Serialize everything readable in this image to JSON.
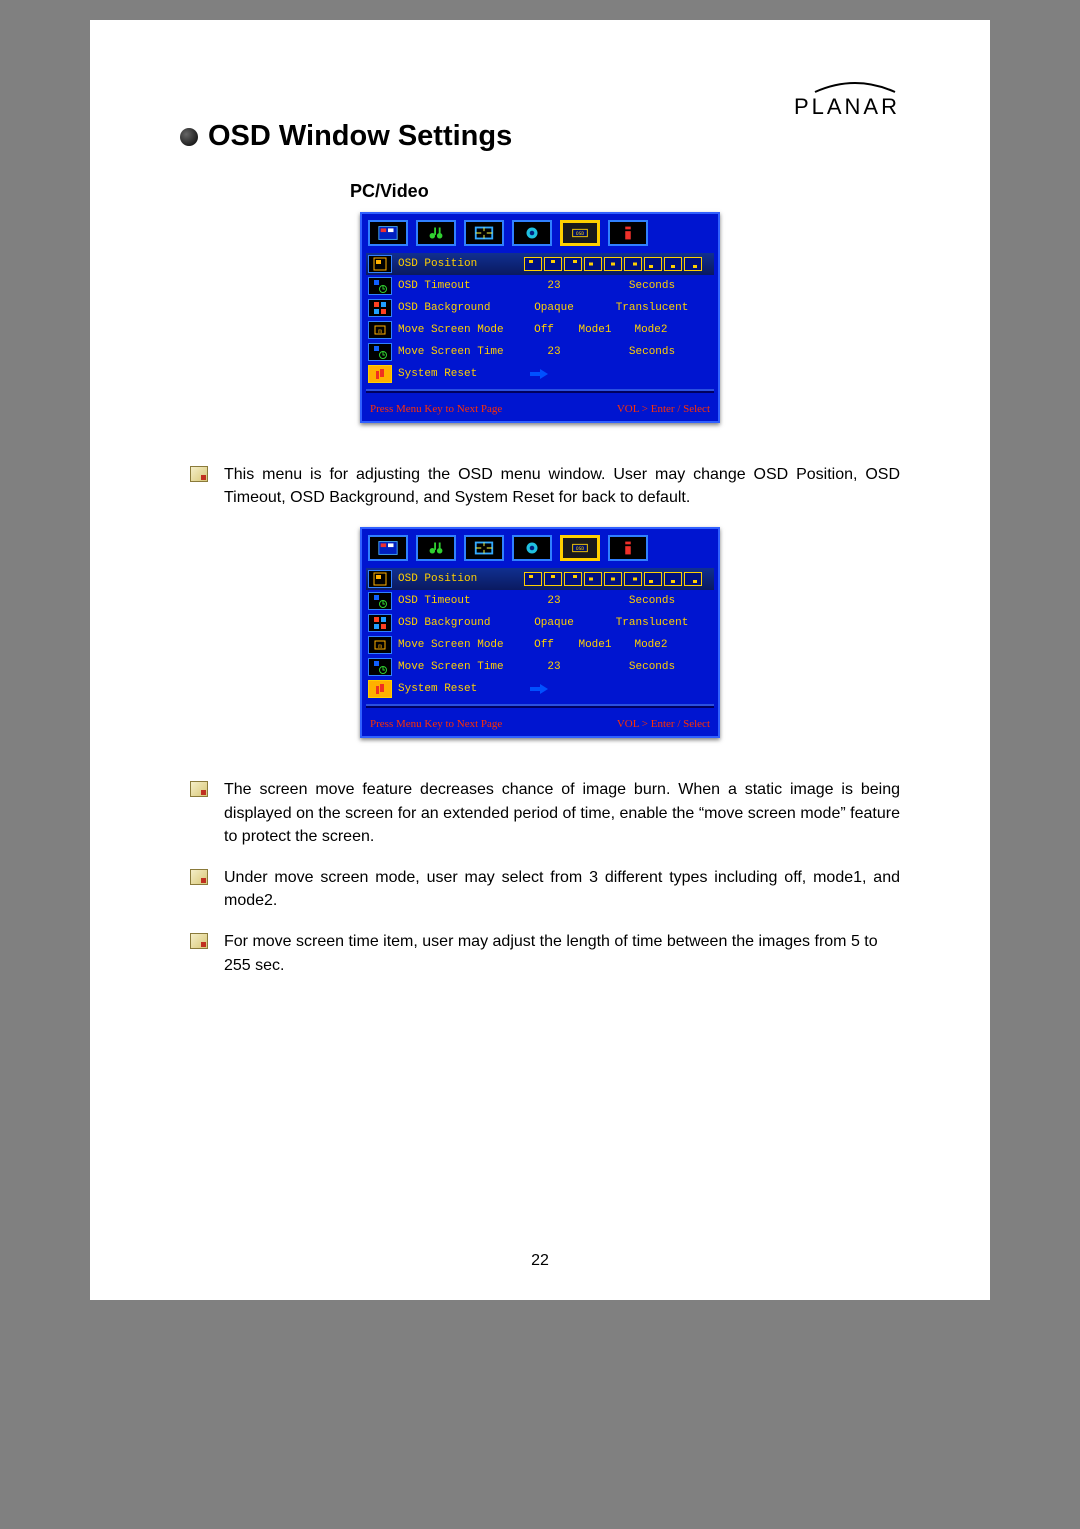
{
  "brand": "PLANAR",
  "heading": "OSD Window Settings",
  "sub_heading": "PC/Video",
  "page_number": "22",
  "osd": {
    "rows": [
      {
        "icon": "position",
        "label": "OSD Position",
        "type": "positions"
      },
      {
        "icon": "timeout",
        "label": "OSD Timeout",
        "v1": "23",
        "v2": "Seconds"
      },
      {
        "icon": "background",
        "label": "OSD Background",
        "v1": "Opaque",
        "v2": "Translucent"
      },
      {
        "icon": "movemode",
        "label": "Move Screen Mode",
        "v1": "Off",
        "v2": "Mode1",
        "v3": "Mode2"
      },
      {
        "icon": "movetime",
        "label": "Move Screen Time",
        "v1": "23",
        "v2": "Seconds"
      },
      {
        "icon": "reset",
        "label": "System Reset",
        "type": "arrow"
      }
    ],
    "foot_left": "Press Menu Key to Next Page",
    "foot_right": "VOL > Enter / Select"
  },
  "paragraphs": [
    "This menu is for adjusting the OSD menu window. User may change OSD Position, OSD Timeout, OSD Background, and System Reset for back to default.",
    "The screen move feature decreases chance of image burn. When a static image is being displayed on the screen for an extended period of time, enable the “move screen mode” feature to protect the screen.",
    "Under move screen mode, user may select from 3 different types including off, mode1, and mode2.",
    "For move screen time item, user may adjust the length of time between the images from 5 to 255 sec."
  ]
}
